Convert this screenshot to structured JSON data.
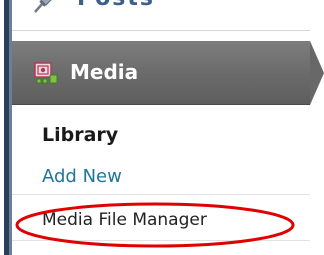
{
  "sidebar": {
    "posts_label": "Posts",
    "media_label": "Media",
    "submenu": {
      "library_label": "Library",
      "add_new_label": "Add New",
      "media_file_manager_label": "Media File Manager"
    }
  },
  "colors": {
    "media_header": "#6a6a6a",
    "link": "#21759b",
    "highlight": "#e00000"
  },
  "icons": {
    "posts": "pushpin-icon",
    "media": "media-gallery-icon"
  }
}
